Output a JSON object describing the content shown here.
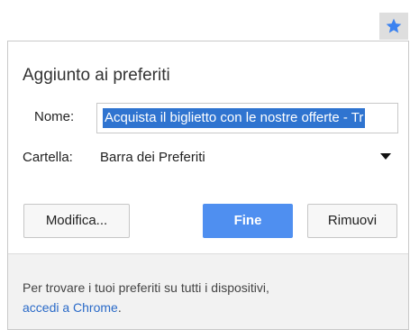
{
  "bookmark_bubble": {
    "title": "Aggiunto ai preferiti",
    "name_label": "Nome:",
    "name_value": "Acquista il biglietto con le nostre offerte - Tr",
    "folder_label": "Cartella:",
    "folder_value": "Barra dei Preferiti",
    "edit_label": "Modifica...",
    "done_label": "Fine",
    "remove_label": "Rimuovi",
    "footer_text": "Per trovare i tuoi preferiti su tutti i dispositivi,",
    "footer_link": "accedi a Chrome",
    "footer_end": "."
  },
  "icons": {
    "star": "star-icon",
    "caret": "chevron-down-icon"
  },
  "colors": {
    "accent": "#4f8ff0",
    "selection": "#2f74d0",
    "link": "#2a6ac8",
    "star": "#3b82f0"
  }
}
